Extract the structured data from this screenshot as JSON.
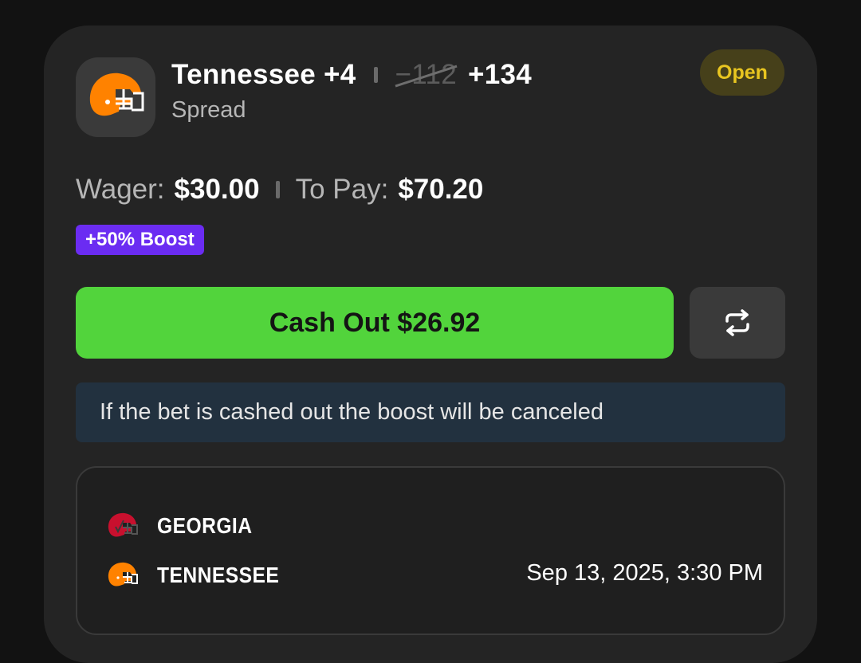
{
  "bet": {
    "selection": "Tennessee +4",
    "old_odds": "−112",
    "new_odds": "+134",
    "market": "Spread",
    "status": "Open"
  },
  "amounts": {
    "wager_label": "Wager:",
    "wager_value": "$30.00",
    "topay_label": "To Pay:",
    "topay_value": "$70.20"
  },
  "boost": {
    "label": "+50% Boost"
  },
  "actions": {
    "cashout_label": "Cash Out $26.92",
    "refresh_icon": "refresh-arrows-icon"
  },
  "notice": {
    "text": "If the bet is cashed out the boost will be canceled"
  },
  "game": {
    "teams": [
      {
        "name": "GEORGIA",
        "icon": "georgia-helmet-icon",
        "color": "#c8102e"
      },
      {
        "name": "TENNESSEE",
        "icon": "tennessee-helmet-icon",
        "color": "#ff8200"
      }
    ],
    "datetime": "Sep 13, 2025, 3:30 PM"
  },
  "colors": {
    "status": "#e8c520",
    "boost": "#6b2cf2",
    "cashout": "#52d43c",
    "notice": "#22313f"
  }
}
